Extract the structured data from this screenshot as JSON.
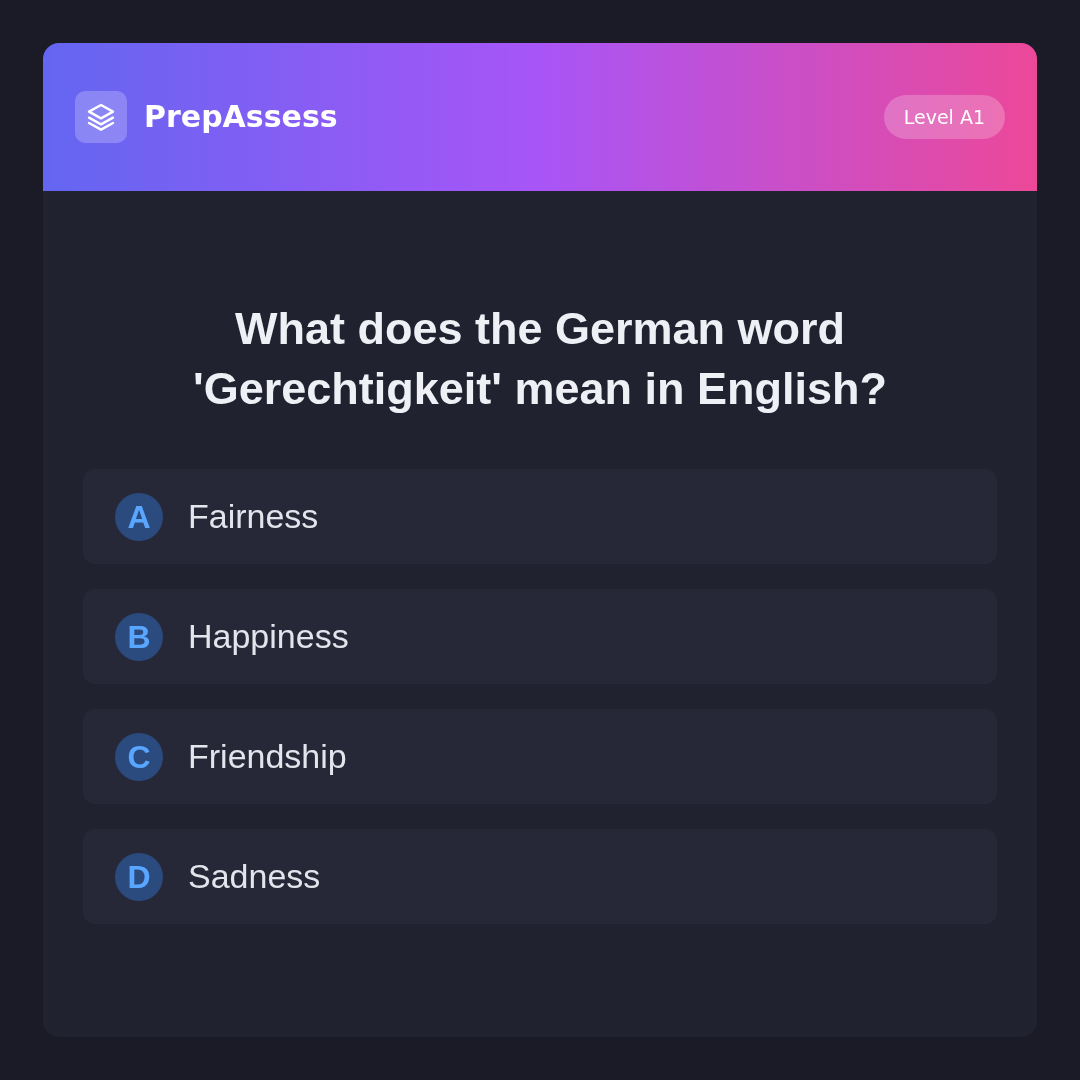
{
  "header": {
    "brand": "PrepAssess",
    "badge": "Level A1"
  },
  "question": "What does the German word 'Gerechtigkeit' mean in English?",
  "options": [
    {
      "letter": "A",
      "text": "Fairness"
    },
    {
      "letter": "B",
      "text": "Happiness"
    },
    {
      "letter": "C",
      "text": "Friendship"
    },
    {
      "letter": "D",
      "text": "Sadness"
    }
  ]
}
